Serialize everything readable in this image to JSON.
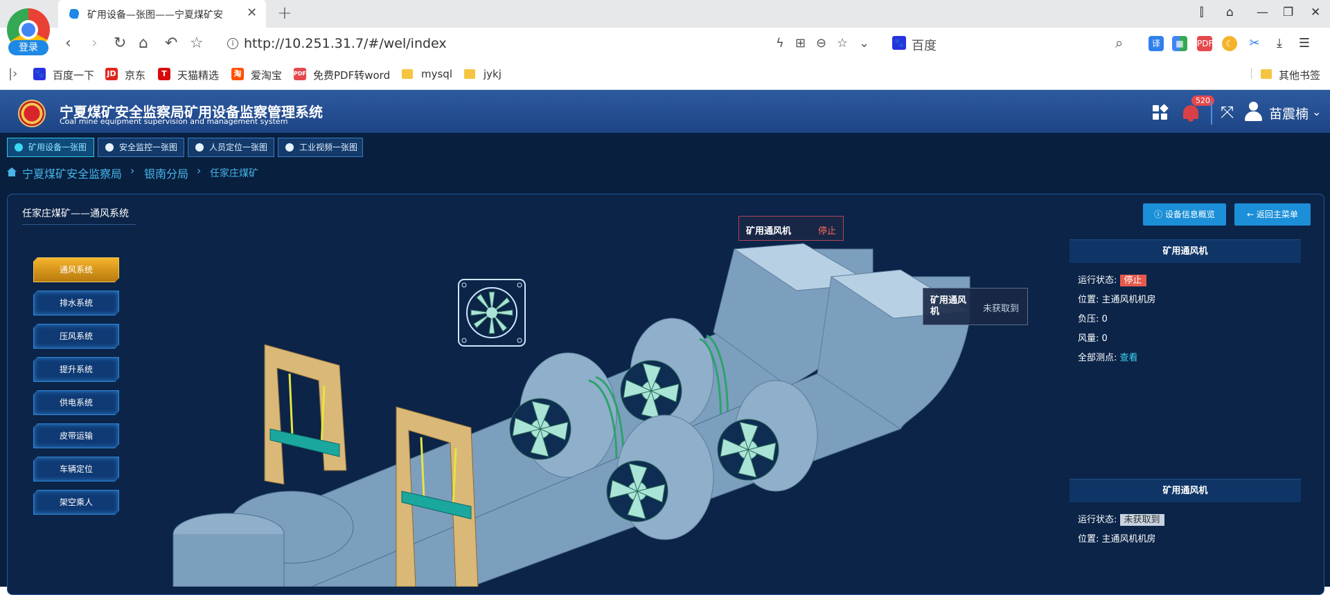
{
  "browser": {
    "login_label": "登录",
    "tab_title": "矿用设备—张图——宁夏煤矿安",
    "url": "http://10.251.31.7/#/wel/index",
    "search_engine": "百度",
    "bookmarks": [
      {
        "label": "百度一下",
        "icon": "baidu-paw-icon"
      },
      {
        "label": "京东",
        "icon": "jd-icon"
      },
      {
        "label": "天猫精选",
        "icon": "tmall-icon"
      },
      {
        "label": "爱淘宝",
        "icon": "taobao-icon"
      },
      {
        "label": "免费PDF转word",
        "icon": "pdf-icon"
      },
      {
        "label": "mysql",
        "icon": "folder-icon"
      },
      {
        "label": "jykj",
        "icon": "folder-icon"
      }
    ],
    "other_bookmarks": "其他书签"
  },
  "app": {
    "title": "宁夏煤矿安全监察局矿用设备监察管理系统",
    "subtitle": "Coal mine equipment supervision and management system",
    "notification_count": "520",
    "user_name": "苗震楠"
  },
  "top_tabs": [
    {
      "label": "矿用设备一张图",
      "active": true
    },
    {
      "label": "安全监控一张图",
      "active": false
    },
    {
      "label": "人员定位一张图",
      "active": false
    },
    {
      "label": "工业视频一张图",
      "active": false
    }
  ],
  "breadcrumb": [
    "宁夏煤矿安全监察局",
    "银南分局",
    "任家庄煤矿"
  ],
  "panel": {
    "title": "任家庄煤矿——通风系统",
    "overview_button": "设备信息概览",
    "back_button": "返回主菜单"
  },
  "side_menu": [
    {
      "label": "通风系统",
      "active": true
    },
    {
      "label": "排水系统",
      "active": false
    },
    {
      "label": "压风系统",
      "active": false
    },
    {
      "label": "提升系统",
      "active": false
    },
    {
      "label": "供电系统",
      "active": false
    },
    {
      "label": "皮带运输",
      "active": false
    },
    {
      "label": "车辆定位",
      "active": false
    },
    {
      "label": "架空乘人",
      "active": false
    }
  ],
  "callouts": {
    "fan1": {
      "name": "矿用通风机",
      "status": "停止"
    },
    "fan2": {
      "name": "矿用通风机",
      "status": "未获取到"
    }
  },
  "info_cards": [
    {
      "title": "矿用通风机",
      "status_label": "运行状态:",
      "status": "停止",
      "location_label": "位置:",
      "location": "主通风机机房",
      "load_label": "负压:",
      "load": "0",
      "airflow_label": "风量:",
      "airflow": "0",
      "points_label": "全部测点:",
      "points_link": "查看"
    },
    {
      "title": "矿用通风机",
      "status_label": "运行状态:",
      "status": "未获取到",
      "location_label": "位置:",
      "location": "主通风机机房"
    }
  ],
  "colors": {
    "header_bg": "#2d5aa0",
    "body_bg": "#081f3e",
    "status_stop": "#e55a4e",
    "link": "#3dd6f5",
    "active_menu": "#f5b32b"
  }
}
